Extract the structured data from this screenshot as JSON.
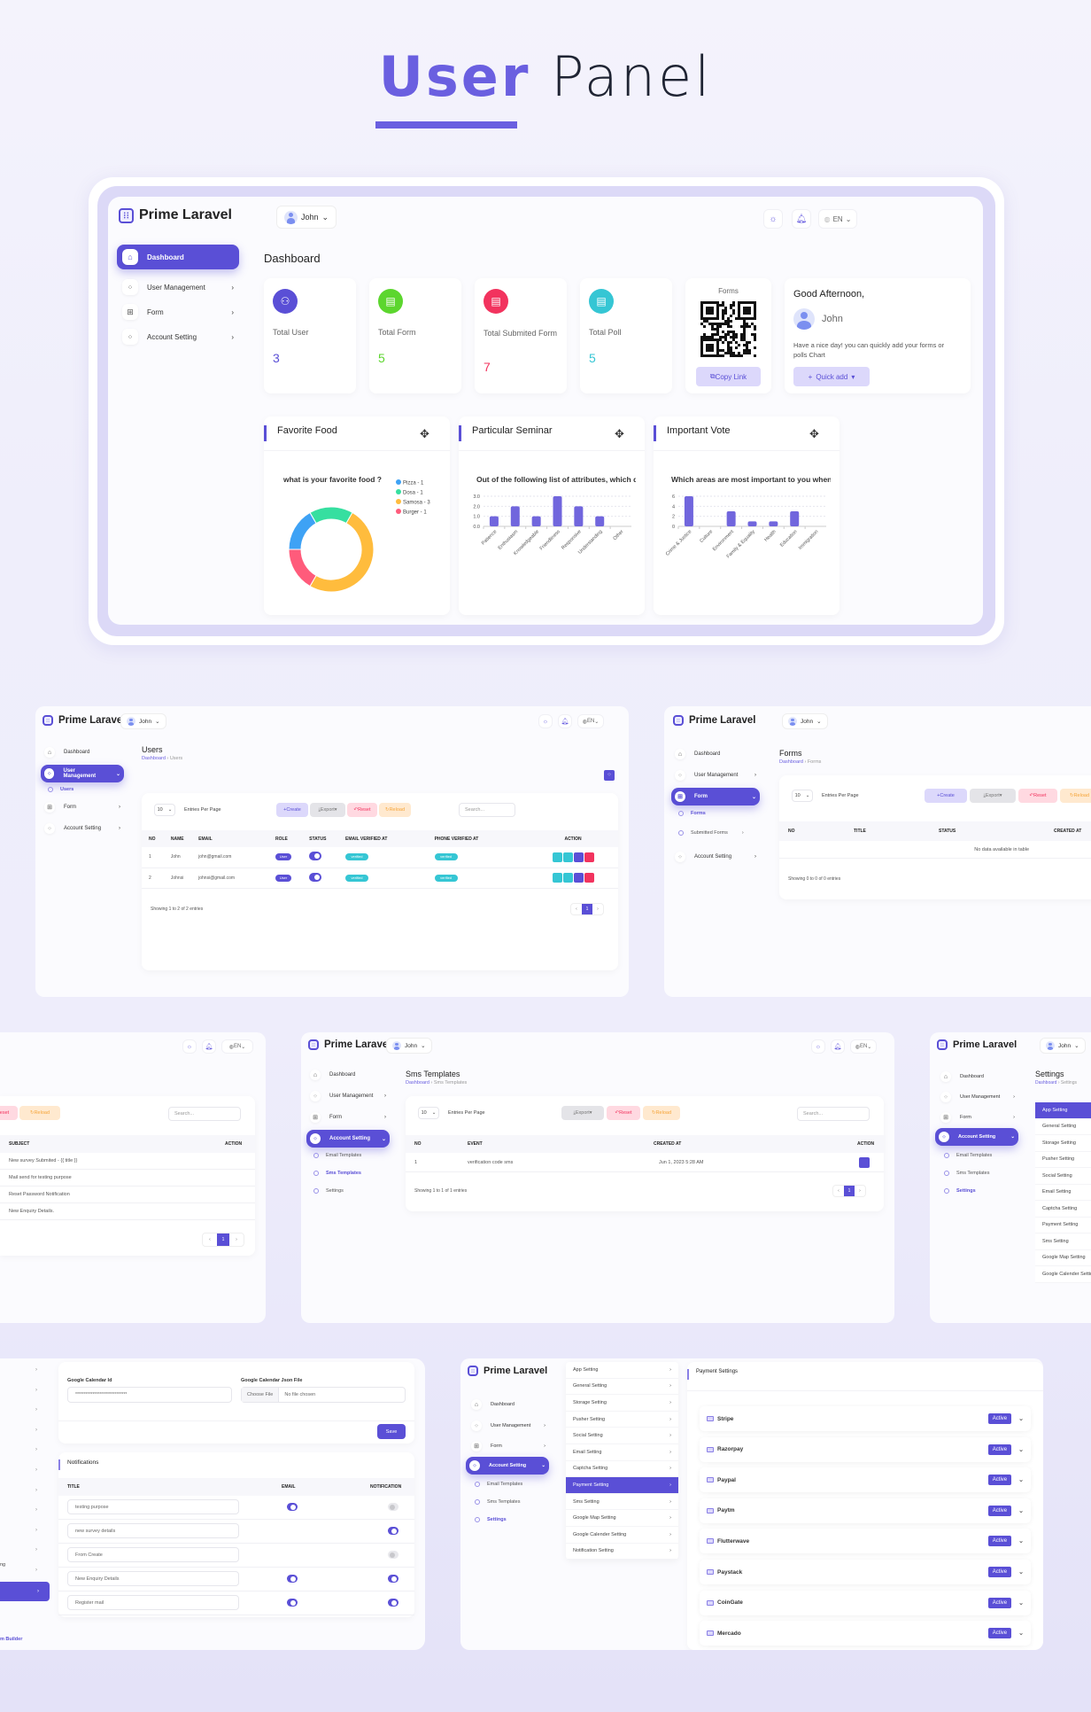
{
  "hero": {
    "title_accent": "User",
    "title_rest": "Panel"
  },
  "colors": {
    "primary": "#5a4fd6",
    "accent_title": "#6a5fe0",
    "green": "#5cd62e",
    "red": "#f2335e",
    "cyan": "#35c6d4"
  },
  "app": {
    "brand": "Prime Laravel",
    "user": "John",
    "lang": "EN",
    "icons": {
      "theme": "sun-icon",
      "notify": "bell-icon",
      "lang": "globe-icon"
    }
  },
  "sidebar": {
    "dashboard": "Dashboard",
    "user_management": "User Management",
    "form": "Form",
    "account_setting": "Account Setting",
    "users": "Users",
    "forms": "Forms",
    "submitted_forms": "Submitted Forms",
    "email_templates": "Email Templates",
    "sms_templates": "Sms Templates",
    "settings": "Settings",
    "form_builder_partial": "m Builder"
  },
  "dashboard": {
    "page_title": "Dashboard",
    "stats": [
      {
        "label": "Total User",
        "value": "3"
      },
      {
        "label": "Total Form",
        "value": "5"
      },
      {
        "label": "Total Submited Form",
        "value": "7"
      },
      {
        "label": "Total Poll",
        "value": "5"
      }
    ],
    "qr": {
      "title": "Forms",
      "copy_label": "Copy Link"
    },
    "greeting": {
      "title": "Good Afternoon,",
      "name": "John",
      "text": "Have a nice day! you can quickly add your forms or polls Chart",
      "quick_add": "Quick add"
    }
  },
  "chart_data": [
    {
      "type": "pie",
      "card_title": "Favorite Food",
      "title": "what is your favorite food ?",
      "categories": [
        "Pizza",
        "Dosa",
        "Samosa",
        "Burger"
      ],
      "values": [
        1,
        1,
        3,
        1
      ],
      "legend": [
        "Pizza - 1",
        "Dosa - 1",
        "Samosa - 3",
        "Burger - 1"
      ],
      "colors": [
        "#3ea2f5",
        "#36dfa0",
        "#ffbc3d",
        "#ff5b7b"
      ],
      "legend_position": "right"
    },
    {
      "type": "bar",
      "card_title": "Particular Seminar",
      "title": "Out of the following list of attributes, which do",
      "categories": [
        "Patience",
        "Enthusiasm",
        "Knowledgeable",
        "Friendliness",
        "Responsive",
        "Understanding",
        "Other"
      ],
      "values": [
        1,
        2,
        1,
        3,
        2,
        1,
        0
      ],
      "yticks": [
        "0.0",
        "1.0",
        "2.0",
        "3.0"
      ],
      "ylim": [
        0,
        3
      ],
      "grid": true
    },
    {
      "type": "bar",
      "card_title": "Important Vote",
      "title": "Which areas are most important to you when y",
      "categories": [
        "Crime & Justice",
        "Culture",
        "Environment",
        "Family & Equality",
        "Health",
        "Education",
        "Immigration"
      ],
      "values": [
        6,
        0,
        3,
        1,
        1,
        3,
        0
      ],
      "yticks": [
        "0",
        "2",
        "4",
        "6"
      ],
      "ylim": [
        0,
        6
      ],
      "grid": true
    }
  ],
  "common": {
    "entries_value": "10",
    "entries_label": "Entries Per Page",
    "create": "Create",
    "export": "Export",
    "reset": "Reset",
    "reload": "Reload",
    "search_placeholder": "Search...",
    "page": "1",
    "prev": "‹",
    "next": "›"
  },
  "users_page": {
    "title": "Users",
    "breadcrumb": [
      "Dashboard",
      "Users"
    ],
    "columns": [
      "NO",
      "NAME",
      "EMAIL",
      "ROLE",
      "STATUS",
      "EMAIL VERIFIED AT",
      "PHONE VERIFIED AT",
      "ACTION"
    ],
    "rows": [
      {
        "no": "1",
        "name": "John",
        "email": "john@gmail.com",
        "role": "User",
        "email_verified": "verified",
        "phone_verified": "verified"
      },
      {
        "no": "2",
        "name": "Johnsi",
        "email": "johnsi@gmail.com",
        "role": "User",
        "email_verified": "verified",
        "phone_verified": "verified"
      }
    ],
    "footer": "Showing 1 to 2 of 2 entries"
  },
  "forms_page": {
    "title": "Forms",
    "breadcrumb": [
      "Dashboard",
      "Forms"
    ],
    "columns": [
      "NO",
      "TITLE",
      "STATUS",
      "CREATED AT"
    ],
    "empty": "No data available in table",
    "footer": "Showing 0 to 0 of 0 entries"
  },
  "email_templates_page": {
    "columns": [
      "SUBJECT",
      "ACTION"
    ],
    "rows": [
      "New survey Submited - {{ title }}",
      "Mail send for testing purpose",
      "Reset Password Notification",
      "New Enquiry Details."
    ]
  },
  "sms_page": {
    "title": "Sms Templates",
    "breadcrumb": [
      "Dashboard",
      "Sms Templates"
    ],
    "columns": [
      "NO",
      "EVENT",
      "CREATED AT",
      "ACTION"
    ],
    "rows": [
      {
        "no": "1",
        "event": "verification code sms",
        "created": "Jun 1, 2023 5:28 AM"
      }
    ],
    "footer": "Showing 1 to 1 of 1 entries"
  },
  "settings_page": {
    "title": "Settings",
    "breadcrumb": [
      "Dashboard",
      "Settings"
    ],
    "items": [
      "App Setting",
      "General Setting",
      "Storage Setting",
      "Pusher Setting",
      "Social Setting",
      "Email Setting",
      "Captcha Setting",
      "Payment Setting",
      "Sms Setting",
      "Google Map Setting",
      "Google Calender Setting",
      "Notification Setting"
    ]
  },
  "calendar_notifications": {
    "cal_id_label": "Google Calendar Id",
    "cal_id_value": "******************************",
    "json_label": "Google Calendar Json File",
    "choose_file": "Choose File",
    "no_file": "No file chosen",
    "save": "Save",
    "notif_title": "Notifications",
    "columns": [
      "TITLE",
      "EMAIL",
      "NOTIFICATION"
    ],
    "rows": [
      {
        "title": "testing purpose",
        "email": true,
        "notification": false
      },
      {
        "title": "new survey details",
        "email": null,
        "notification": true
      },
      {
        "title": "From Create",
        "email": null,
        "notification": false
      },
      {
        "title": "New Enquiry Details",
        "email": true,
        "notification": true
      },
      {
        "title": "Register mail",
        "email": true,
        "notification": true
      }
    ]
  },
  "payment_page": {
    "title": "Payment Settings",
    "status": "Active",
    "gateways": [
      "Stripe",
      "Razorpay",
      "Paypal",
      "Paytm",
      "Flutterwave",
      "Paystack",
      "CoinGate",
      "Mercado"
    ]
  }
}
